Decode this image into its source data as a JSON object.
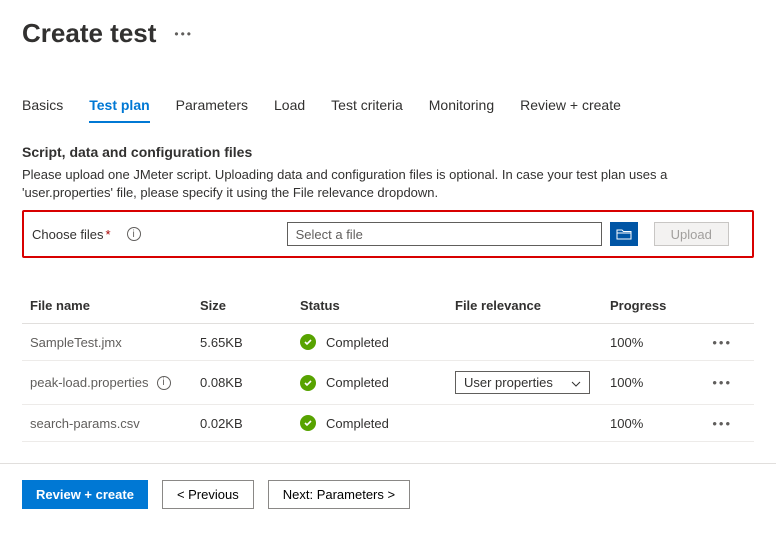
{
  "header": {
    "title": "Create test"
  },
  "tabs": {
    "items": [
      "Basics",
      "Test plan",
      "Parameters",
      "Load",
      "Test criteria",
      "Monitoring",
      "Review + create"
    ],
    "active_index": 1
  },
  "section": {
    "title": "Script, data and configuration files",
    "description": "Please upload one JMeter script. Uploading data and configuration files is optional. In case your test plan uses a 'user.properties' file, please specify it using the File relevance dropdown."
  },
  "choose": {
    "label": "Choose files",
    "placeholder": "Select a file",
    "upload_label": "Upload"
  },
  "table": {
    "headers": {
      "file_name": "File name",
      "size": "Size",
      "status": "Status",
      "file_relevance": "File relevance",
      "progress": "Progress"
    },
    "rows": [
      {
        "name": "SampleTest.jmx",
        "info": false,
        "size": "5.65KB",
        "status": "Completed",
        "relevance": null,
        "progress": "100%"
      },
      {
        "name": "peak-load.properties",
        "info": true,
        "size": "0.08KB",
        "status": "Completed",
        "relevance": "User properties",
        "progress": "100%"
      },
      {
        "name": "search-params.csv",
        "info": false,
        "size": "0.02KB",
        "status": "Completed",
        "relevance": null,
        "progress": "100%"
      }
    ]
  },
  "footer": {
    "review": "Review + create",
    "previous": "< Previous",
    "next": "Next: Parameters >"
  }
}
